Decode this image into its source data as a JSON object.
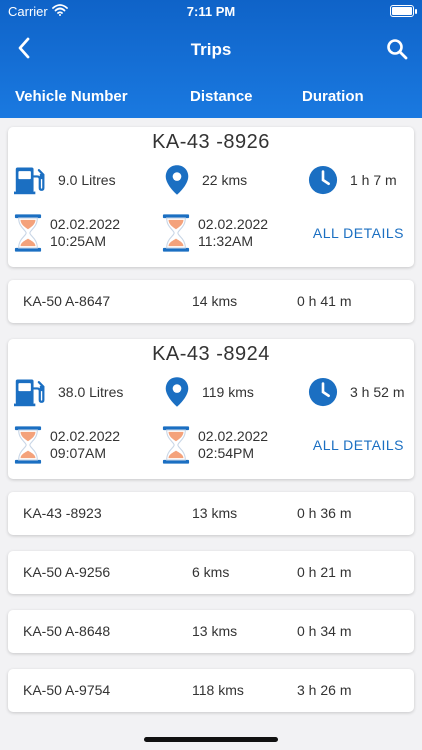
{
  "status_bar": {
    "carrier": "Carrier",
    "time": "7:11 PM"
  },
  "navbar": {
    "title": "Trips",
    "back_icon": "chevron-left-icon",
    "search_icon": "search-icon"
  },
  "columns": {
    "vehicle": "Vehicle Number",
    "distance": "Distance",
    "duration": "Duration"
  },
  "colors": {
    "header": "#1a72d8",
    "accent": "#1b6fc2",
    "fuel_icon": "#1b6fc2",
    "hourglass_sand": "#f4a27b"
  },
  "trips": [
    {
      "vehicle": "KA-43 -8926",
      "fuel": "9.0 Litres",
      "distance": "22 kms",
      "duration": "1 h 7 m",
      "start_date": "02.02.2022",
      "start_time": "10:25AM",
      "end_date": "02.02.2022",
      "end_time": "11:32AM",
      "details_label": "ALL DETAILS"
    },
    {
      "vehicle": "KA-50 A-8647",
      "distance": "14 kms",
      "duration": "0 h 41 m"
    },
    {
      "vehicle": "KA-43 -8924",
      "fuel": "38.0 Litres",
      "distance": "119 kms",
      "duration": "3 h 52 m",
      "start_date": "02.02.2022",
      "start_time": "09:07AM",
      "end_date": "02.02.2022",
      "end_time": "02:54PM",
      "details_label": "ALL DETAILS"
    },
    {
      "vehicle": "KA-43 -8923",
      "distance": "13 kms",
      "duration": "0 h 36 m"
    },
    {
      "vehicle": "KA-50 A-9256",
      "distance": "6 kms",
      "duration": "0 h 21 m"
    },
    {
      "vehicle": "KA-50 A-8648",
      "distance": "13 kms",
      "duration": "0 h 34 m"
    },
    {
      "vehicle": "KA-50 A-9754",
      "distance": "118 kms",
      "duration": "3 h 26 m"
    }
  ]
}
